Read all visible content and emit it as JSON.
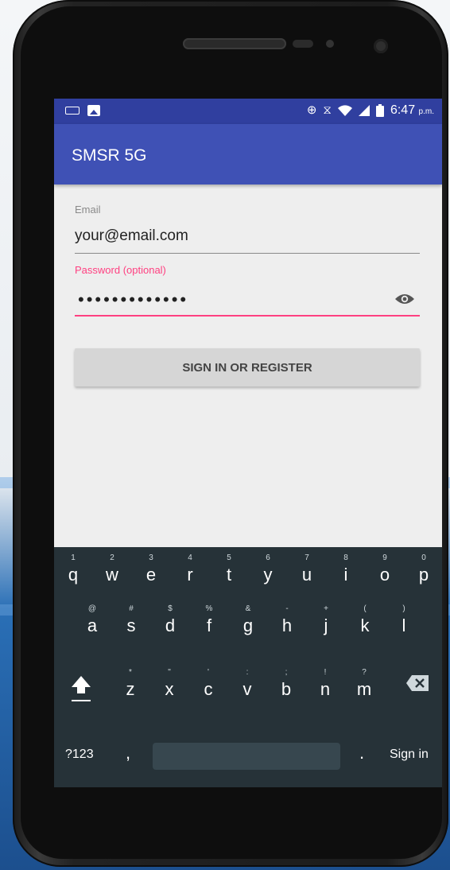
{
  "status_bar": {
    "time": "6:47",
    "time_suffix": "p.m.",
    "left_icons": [
      "keyboard-icon",
      "image-icon"
    ],
    "right_icons": [
      "data-saver-icon",
      "hourglass-icon",
      "wifi-icon",
      "signal-icon",
      "battery-icon"
    ]
  },
  "app": {
    "title": "SMSR 5G"
  },
  "form": {
    "email_label": "Email",
    "email_value": "your@email.com",
    "password_label": "Password (optional)",
    "password_mask": "•••••••••••••",
    "submit_label": "SIGN IN OR REGISTER"
  },
  "keyboard": {
    "row1": [
      {
        "ch": "q",
        "hint": "1"
      },
      {
        "ch": "w",
        "hint": "2"
      },
      {
        "ch": "e",
        "hint": "3"
      },
      {
        "ch": "r",
        "hint": "4"
      },
      {
        "ch": "t",
        "hint": "5"
      },
      {
        "ch": "y",
        "hint": "6"
      },
      {
        "ch": "u",
        "hint": "7"
      },
      {
        "ch": "i",
        "hint": "8"
      },
      {
        "ch": "o",
        "hint": "9"
      },
      {
        "ch": "p",
        "hint": "0"
      }
    ],
    "row2": [
      {
        "ch": "a",
        "hint": "@"
      },
      {
        "ch": "s",
        "hint": "#"
      },
      {
        "ch": "d",
        "hint": "$"
      },
      {
        "ch": "f",
        "hint": "%"
      },
      {
        "ch": "g",
        "hint": "&"
      },
      {
        "ch": "h",
        "hint": "-"
      },
      {
        "ch": "j",
        "hint": "+"
      },
      {
        "ch": "k",
        "hint": "("
      },
      {
        "ch": "l",
        "hint": ")"
      }
    ],
    "row3": [
      {
        "ch": "z",
        "hint": "*"
      },
      {
        "ch": "x",
        "hint": "\""
      },
      {
        "ch": "c",
        "hint": "'"
      },
      {
        "ch": "v",
        "hint": ":"
      },
      {
        "ch": "b",
        "hint": ";"
      },
      {
        "ch": "n",
        "hint": "!"
      },
      {
        "ch": "m",
        "hint": "?"
      }
    ],
    "symbols_label": "?123",
    "comma_label": ",",
    "period_label": ".",
    "action_label": "Sign in"
  },
  "colors": {
    "status_bar": "#303f9f",
    "app_bar": "#3f51b5",
    "accent": "#ff4081",
    "keyboard_bg": "#263238"
  }
}
